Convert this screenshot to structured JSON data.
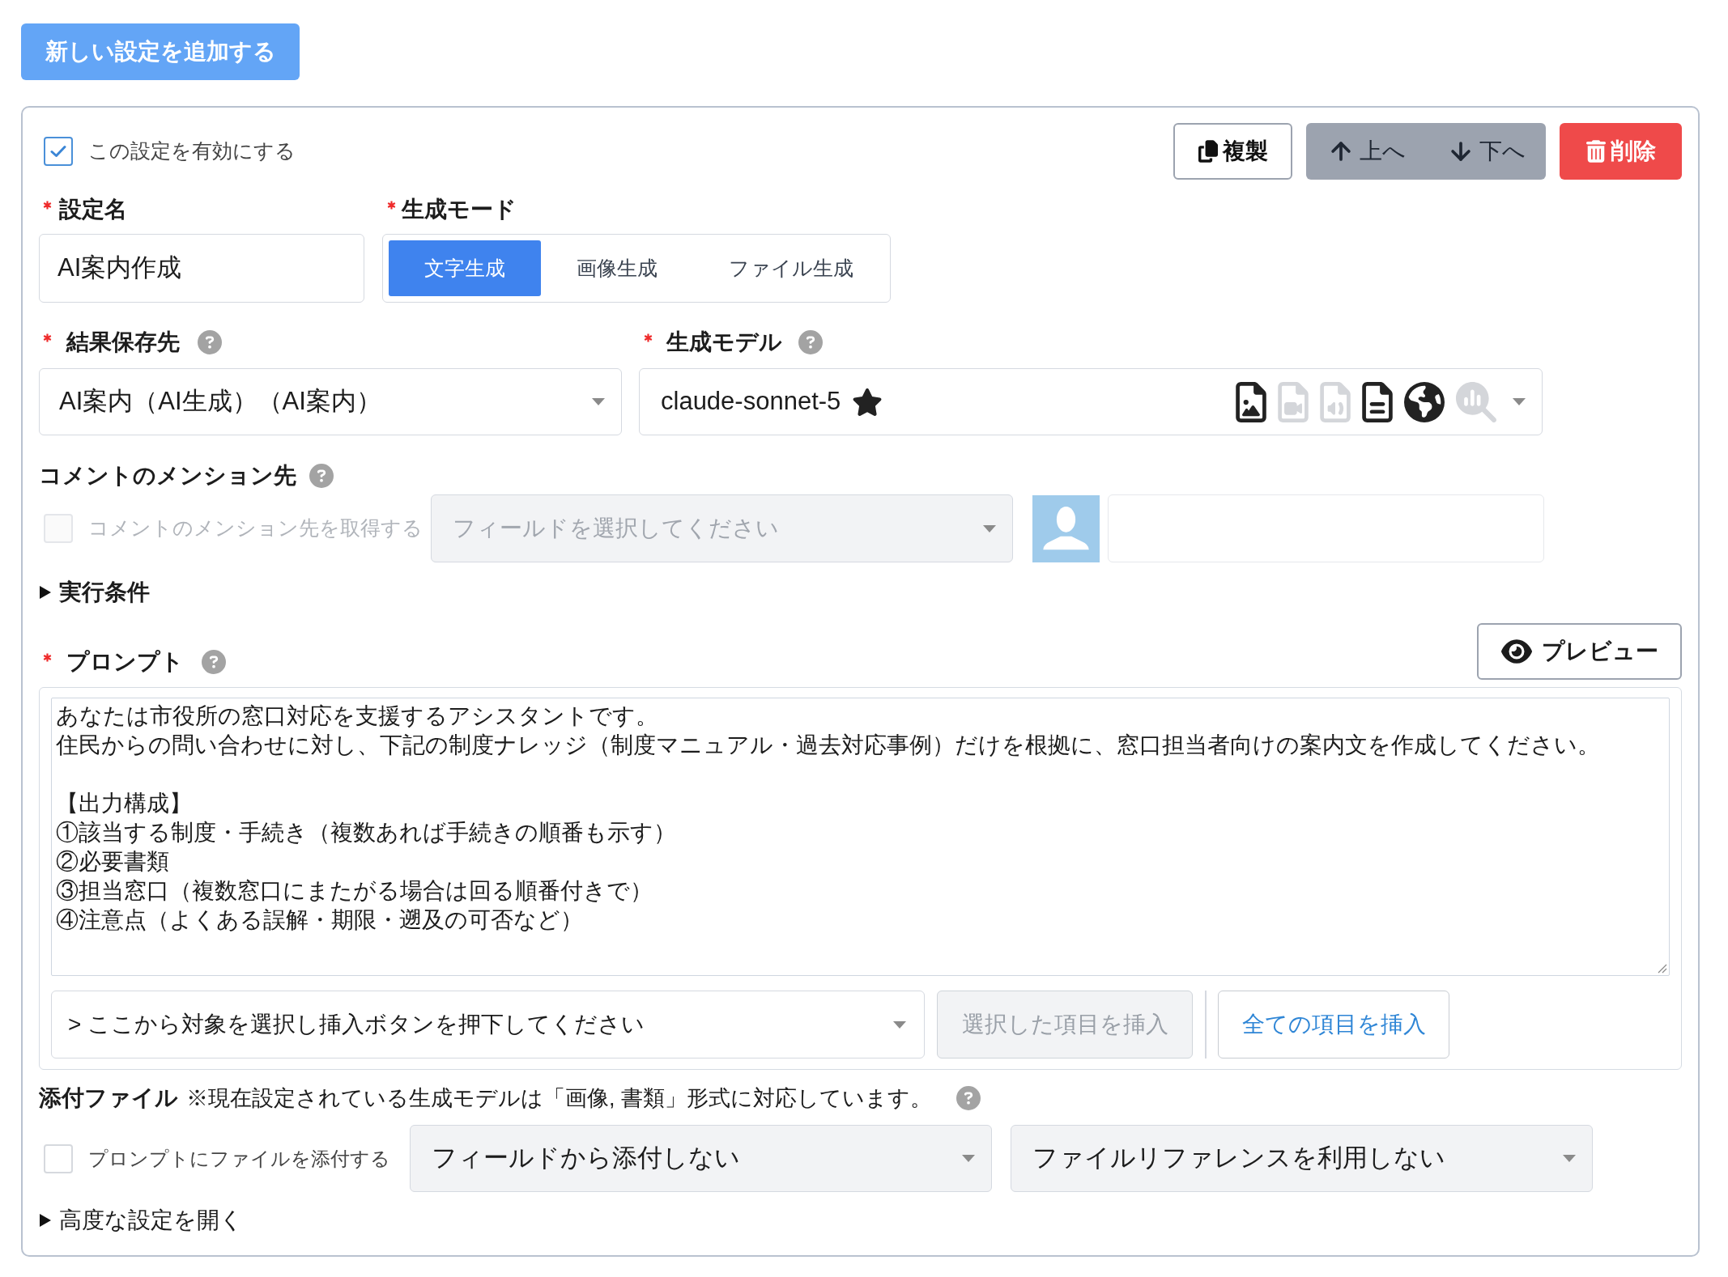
{
  "add_button": {
    "label": "新しい設定を追加する"
  },
  "setting": {
    "enabled_checkbox": {
      "label": "この設定を有効にする",
      "checked": true
    },
    "actions": [
      {
        "kind": "copy",
        "label": "複製"
      },
      {
        "kind": "up",
        "label": "上へ"
      },
      {
        "kind": "down",
        "label": "下へ"
      },
      {
        "kind": "delete",
        "label": "削除"
      }
    ],
    "name_field": {
      "label": "設定名",
      "required": true,
      "value": "AI案内作成"
    },
    "mode": {
      "label": "生成モード",
      "required": true,
      "options": [
        {
          "label": "文字生成",
          "selected": true
        },
        {
          "label": "画像生成",
          "selected": false
        },
        {
          "label": "ファイル生成",
          "selected": false
        }
      ]
    },
    "result_destination": {
      "label": "結果保存先",
      "required": true,
      "value": "AI案内（AI生成）（AI案内）"
    },
    "model": {
      "label": "生成モデル",
      "required": true,
      "value": "claude-sonnet-5",
      "starred": true,
      "capabilities": [
        {
          "kind": "image",
          "enabled": true
        },
        {
          "kind": "video",
          "enabled": false
        },
        {
          "kind": "audio",
          "enabled": false
        },
        {
          "kind": "document",
          "enabled": true
        },
        {
          "kind": "web",
          "enabled": true
        },
        {
          "kind": "analysis",
          "enabled": false
        }
      ]
    },
    "mention": {
      "label": "コメントのメンション先",
      "checkbox": {
        "label": "コメントのメンション先を取得する",
        "checked": false,
        "disabled": true
      },
      "field_select": {
        "placeholder": "フィールドを選択してください",
        "disabled": true
      }
    },
    "conditions": {
      "label": "実行条件",
      "expanded": false
    },
    "prompt": {
      "label": "プロンプト",
      "required": true,
      "preview_button": "プレビュー",
      "paragraphs": [
        {
          "lines": [
            "あなたは市役所の窓口対応を支援するアシスタントです。",
            "住民からの問い合わせに対し、下記の制度ナレッジ（制度マニュアル・過去対応事例）だけを根拠に、窓口担当者向けの案内文を作成してください。"
          ]
        },
        {
          "lines": [
            "【出力構成】",
            "①該当する制度・手続き（複数あれば手続きの順番も示す）",
            "②必要書類",
            "③担当窓口（複数窓口にまたがる場合は回る順番付きで）",
            "④注意点（よくある誤解・期限・遡及の可否など）"
          ]
        }
      ],
      "insert_select": {
        "value": "> ここから対象を選択し挿入ボタンを押下してください"
      },
      "insert_selected_button": {
        "label": "選択した項目を挿入",
        "disabled": true
      },
      "insert_all_button": {
        "label": "全ての項目を挿入",
        "disabled": false
      }
    },
    "attachments": {
      "label": "添付ファイル",
      "note": "※現在設定されている生成モデルは「画像, 書類」形式に対応しています。",
      "checkbox": {
        "label": "プロンプトにファイルを添付する",
        "checked": false,
        "disabled": false
      },
      "field_select": {
        "value": "フィールドから添付しない"
      },
      "reference_select": {
        "value": "ファイルリファレンスを利用しない"
      }
    },
    "advanced": {
      "label": "高度な設定を開く",
      "expanded": false
    }
  }
}
